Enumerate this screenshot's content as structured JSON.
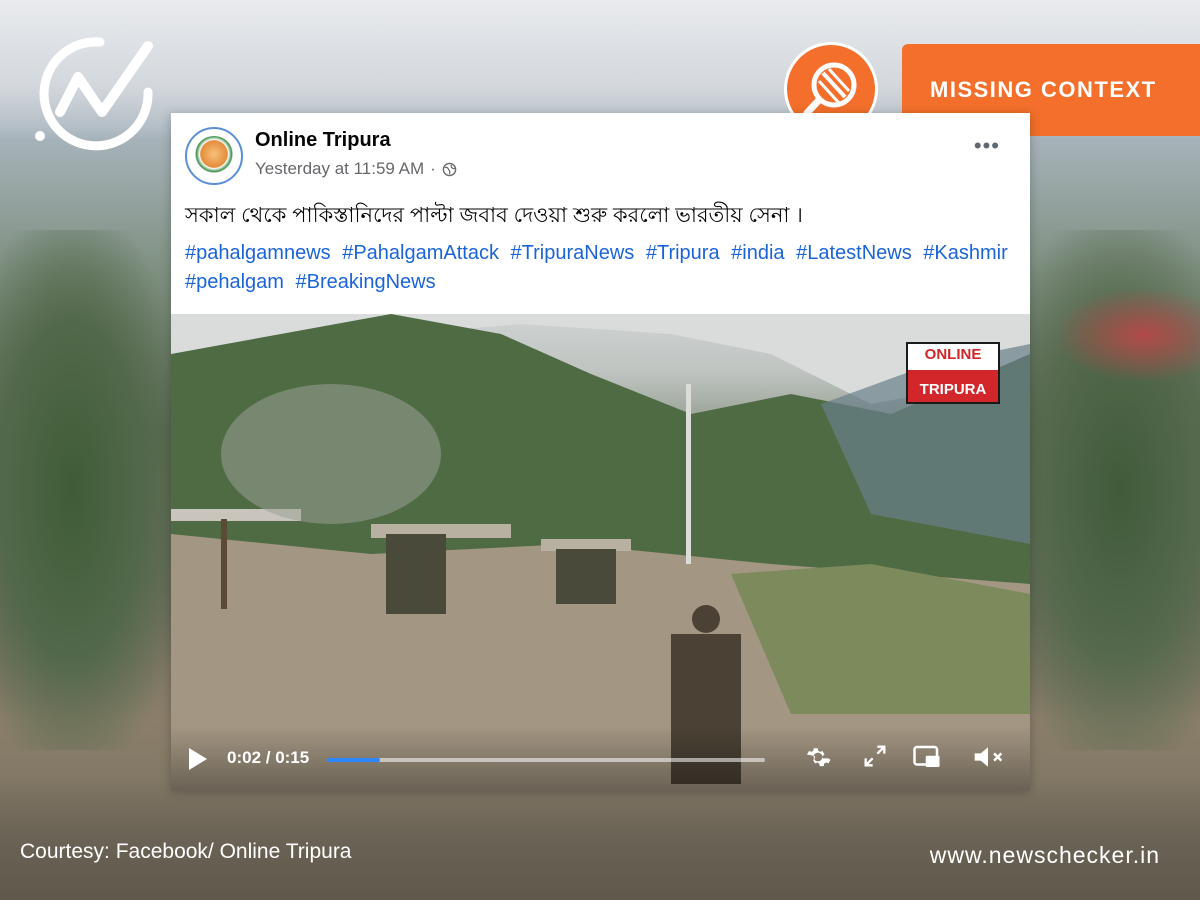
{
  "badge": {
    "label": "MISSING CONTEXT",
    "color": "#f36f2b"
  },
  "post": {
    "page_name": "Online Tripura",
    "time": "Yesterday at 11:59 AM",
    "privacy_symbol": "·",
    "text": "সকাল থেকে পাকিস্তানিদের পাল্টা জবাব দেওয়া শুরু করলো ভারতীয় সেনা ।",
    "hashtags": [
      "#pahalgamnews",
      "#PahalgamAttack",
      "#TripuraNews",
      "#Tripura",
      "#india",
      "#LatestNews",
      "#Kashmir",
      "#pehalgam",
      "#BreakingNews"
    ],
    "more_symbol": "•••"
  },
  "video": {
    "watermark_top": "ONLINE",
    "watermark_bottom": "TRIPURA",
    "time": "0:02 / 0:15",
    "progress": 0.12
  },
  "footer": {
    "courtesy": "Courtesy: Facebook/ Online Tripura",
    "site": "www.newschecker.in"
  },
  "icons": [
    "newschecker-logo-icon",
    "magnifier-badge-icon",
    "globe-icon",
    "play-icon",
    "settings-icon",
    "fullscreen-icon",
    "pip-icon",
    "mute-icon"
  ]
}
